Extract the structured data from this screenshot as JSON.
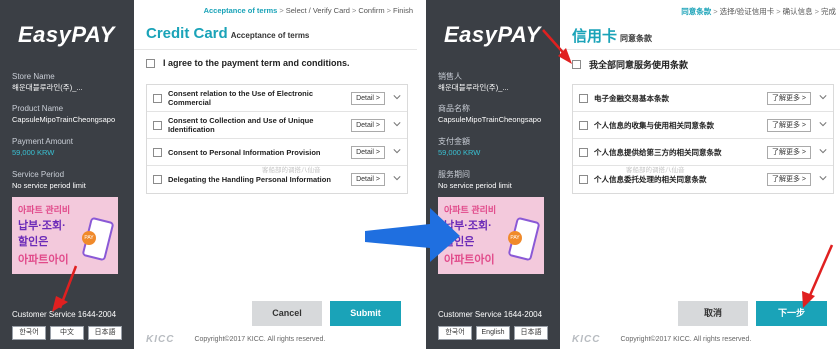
{
  "left": {
    "brand": {
      "easy": "Easy",
      "pay": "PAY"
    },
    "store_label": "Store Name",
    "store_value": "해운대블루라인(주)_...",
    "product_label": "Product Name",
    "product_value": "CapsuleMipoTrainCheongsapo",
    "amount_label": "Payment Amount",
    "amount_value": "59,000 KRW",
    "period_label": "Service Period",
    "period_value": "No service period limit",
    "ad": {
      "l1": "아파트 관리비",
      "l2": "납부·조회·",
      "l3": "할인은",
      "l4": "아파트아이",
      "tag": "PAY"
    },
    "customer_service": "Customer Service 1644-2004",
    "langs": [
      "한국어",
      "中文",
      "日本語"
    ],
    "steps": [
      "Acceptance of terms",
      "Select / Verify Card",
      "Confirm",
      "Finish"
    ],
    "title": "Credit Card",
    "subtitle": "Acceptance of terms",
    "agree_all": "I agree to the payment term and conditions.",
    "terms": [
      "Consent relation to the Use of Electronic Commercial",
      "Consent to Collection and Use of Unique Identification",
      "Consent to Personal Information Provision",
      "Delegating the Handling Personal Information"
    ],
    "detail_label": "Detail >",
    "cancel": "Cancel",
    "submit": "Submit",
    "kicc": "KICC",
    "copyright": "Copyright©2017 KICC. All rights reserved.",
    "watermark": "客船部的调搭八仙音"
  },
  "right": {
    "brand": {
      "easy": "Easy",
      "pay": "PAY"
    },
    "store_label": "销售人",
    "store_value": "해운대블루라인(주)_...",
    "product_label": "商品名称",
    "product_value": "CapsuleMipoTrainCheongsapo",
    "amount_label": "支付金額",
    "amount_value": "59,000 KRW",
    "period_label": "服务期间",
    "period_value": "No service period limit",
    "ad": {
      "l1": "아파트 관리비",
      "l2": "납부·조회·",
      "l3": "할인은",
      "l4": "아파트아이",
      "tag": "PAY"
    },
    "customer_service": "Customer Service 1644-2004",
    "langs": [
      "한국어",
      "English",
      "日本語"
    ],
    "steps": [
      "同意条款",
      "选择/验证信用卡",
      "确认信息",
      "完成"
    ],
    "title": "信用卡",
    "subtitle": "同意条款",
    "agree_all": "我全部同意服务使用条款",
    "terms": [
      "电子金融交易基本条款",
      "个人信息的收集与使用相关同意条款",
      "个人信息提供给第三方的相关同意条款",
      "个人信息委托处理的相关同意条款"
    ],
    "detail_label": "了解更多 >",
    "cancel": "取消",
    "submit": "下一步",
    "kicc": "KICC",
    "copyright": "Copyright©2017 KICC. All rights reserved.",
    "watermark": "客船部的调搭八仙音"
  },
  "colors": {
    "accent": "#1aa3b8",
    "sidebar": "#3b3f45",
    "arrow_red": "#e02020",
    "arrow_blue": "#1f6fe0"
  }
}
